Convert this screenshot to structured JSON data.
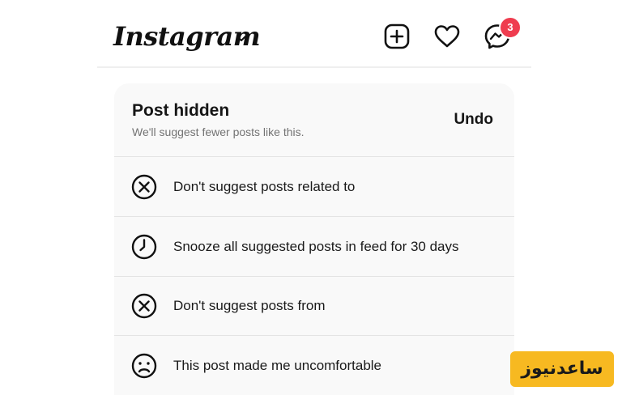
{
  "header": {
    "logo_text": "Instagram",
    "messenger_badge_count": "3"
  },
  "card": {
    "title": "Post hidden",
    "subtitle": "We'll suggest fewer posts like this.",
    "undo_label": "Undo",
    "options": [
      {
        "icon": "x-circle-icon",
        "label": "Don't suggest posts related to"
      },
      {
        "icon": "clock-icon",
        "label": "Snooze all suggested posts in feed for 30 days"
      },
      {
        "icon": "x-circle-icon",
        "label": "Don't suggest posts from"
      },
      {
        "icon": "sad-face-icon",
        "label": "This post made me uncomfortable"
      }
    ]
  },
  "watermark": {
    "text": "ساعدنیوز"
  },
  "colors": {
    "badge": "#ef3c4f",
    "card_background": "#f9f9f9",
    "watermark_background": "#f7b921"
  }
}
